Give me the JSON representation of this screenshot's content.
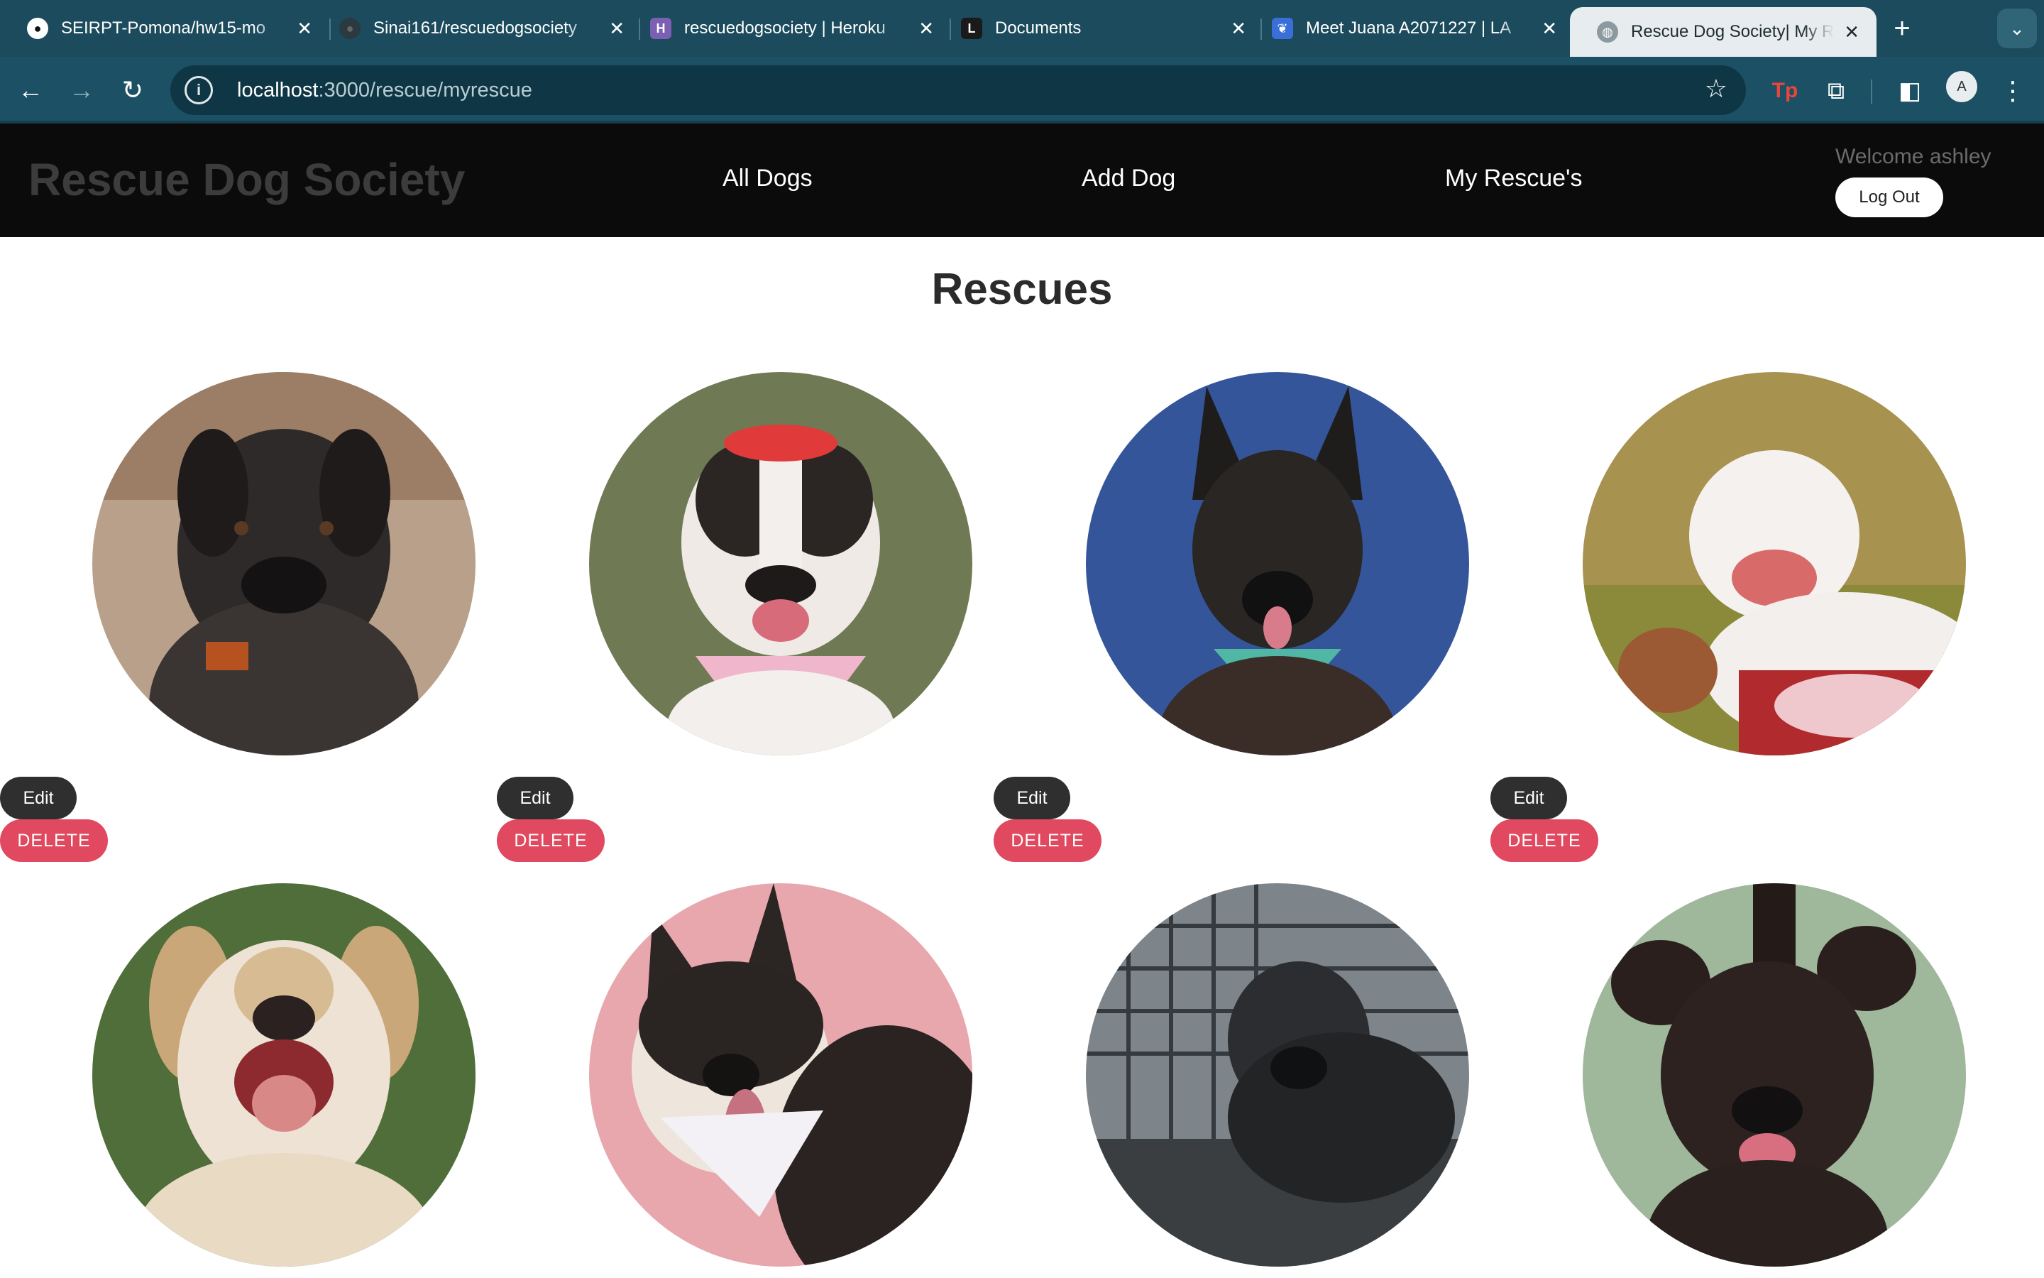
{
  "browser": {
    "tabs": [
      {
        "title": "SEIRPT-Pomona/hw15-mo",
        "favicon": "github-icon"
      },
      {
        "title": "Sinai161/rescuedogsociety",
        "favicon": "github-icon"
      },
      {
        "title": "rescuedogsociety | Heroku",
        "favicon": "heroku-icon"
      },
      {
        "title": "Documents",
        "favicon": "documents-icon"
      },
      {
        "title": "Meet Juana A2071227 | LA",
        "favicon": "paw-icon"
      },
      {
        "title": "Rescue Dog Society| My R",
        "favicon": "globe-icon"
      }
    ],
    "url_host": "localhost",
    "url_path": ":3000/rescue/myrescue",
    "profile_initial": "A"
  },
  "navbar": {
    "brand": "Rescue Dog Society",
    "links": [
      "All Dogs",
      "Add Dog",
      "My Rescue's"
    ],
    "welcome": "Welcome ashley",
    "logout_label": "Log Out"
  },
  "page": {
    "title": "Rescues",
    "edit_label": "Edit",
    "delete_label": "DELETE"
  },
  "colors": {
    "tabstrip": "#1b4b5c",
    "toolbar": "#1c5064",
    "navbar": "#0b0b0b",
    "edit": "#2f2f2f",
    "delete": "#e0495f"
  }
}
